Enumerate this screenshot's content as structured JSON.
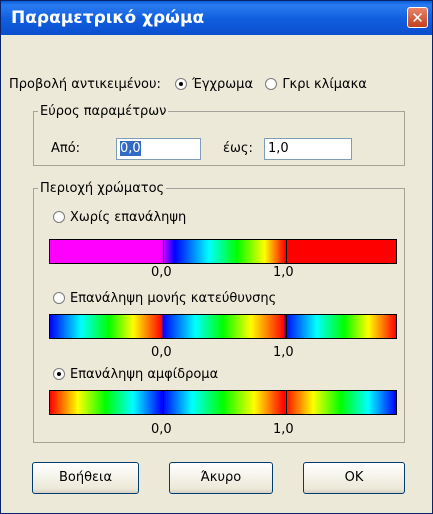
{
  "dialog": {
    "title": "Παραμετρικό χρώμα",
    "close_glyph": "✕"
  },
  "view": {
    "label": "Προβολή αντικειμένου:",
    "options": [
      {
        "label": "Έγχρωμα",
        "checked": true
      },
      {
        "label": "Γκρι κλίμακα",
        "checked": false
      }
    ]
  },
  "range": {
    "legend": "Εύρος παραμέτρων",
    "from_label": "Από:",
    "from_value": "0,0",
    "to_label": "έως:",
    "to_value": "1,0"
  },
  "color_area": {
    "legend": "Περιοχή χρώματος",
    "options": [
      {
        "label": "Χωρίς επανάληψη",
        "checked": false,
        "tick_start": "0,0",
        "tick_end": "1,0"
      },
      {
        "label": "Επανάληψη μονής κατεύθυνσης",
        "checked": false,
        "tick_start": "0,0",
        "tick_end": "1,0"
      },
      {
        "label": "Επανάληψη αμφίδρομα",
        "checked": true,
        "tick_start": "0,0",
        "tick_end": "1,0"
      }
    ]
  },
  "buttons": {
    "help": "Βοήθεια",
    "cancel": "Άκυρο",
    "ok": "OK"
  },
  "colors": {
    "title_bar": "#1160e0",
    "close_button": "#d2522f",
    "dialog_bg": "#ece9d8",
    "selection": "#316ac5"
  }
}
